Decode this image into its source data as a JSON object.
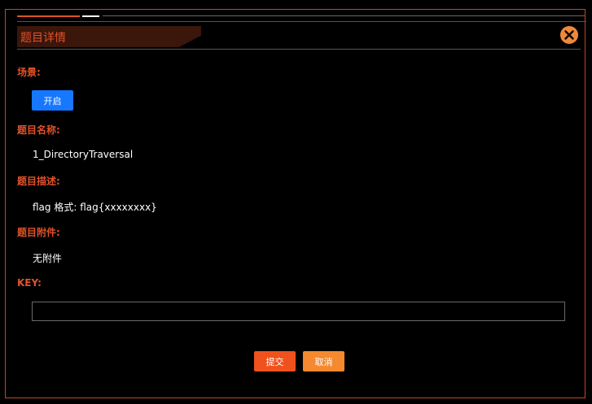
{
  "dialog": {
    "title": "题目详情",
    "close_icon": "close-circle-icon"
  },
  "scene": {
    "label": "场景:",
    "button_label": "开启"
  },
  "name": {
    "label": "题目名称:",
    "value": "1_DirectoryTraversal"
  },
  "description": {
    "label": "题目描述:",
    "value": "flag 格式: flag{xxxxxxxx}"
  },
  "attachment": {
    "label": "题目附件:",
    "value": "无附件"
  },
  "key": {
    "label": "KEY:",
    "value": "",
    "placeholder": ""
  },
  "actions": {
    "submit_label": "提交",
    "cancel_label": "取消"
  },
  "colors": {
    "accent": "#e0522a",
    "primary_button": "#1677ff",
    "submit_button": "#f0521e",
    "cancel_button": "#f5892f",
    "close_icon": "#f0883a"
  }
}
